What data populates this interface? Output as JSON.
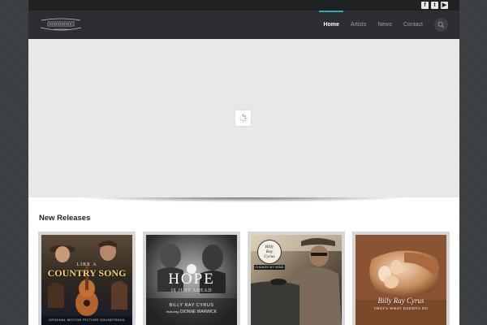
{
  "social": {
    "facebook": "f",
    "twitter": "t",
    "youtube": "▶"
  },
  "nav": {
    "items": [
      {
        "label": "Home",
        "active": true
      },
      {
        "label": "Artists",
        "active": false
      },
      {
        "label": "News",
        "active": false
      },
      {
        "label": "Contact",
        "active": false
      }
    ]
  },
  "section": {
    "title": "New Releases"
  },
  "releases": [
    {
      "title_line1": "LIKE A",
      "title_line2": "COUNTRY SONG",
      "footer": "ORIGINAL MOTION PICTURE SOUNDTRACK"
    },
    {
      "title": "HOPE",
      "subtitle": "IS JUST AHEAD",
      "artist": "BILLY RAY CYRUS",
      "featuring": "featuring",
      "guest": "DIONNE WARWICK"
    },
    {
      "badge_line1": "Billy",
      "badge_line2": "Ray",
      "badge_line3": "Cyrus",
      "badge_sub": "CHANGE MY MIND"
    },
    {
      "artist": "Billy Ray Cyrus",
      "title": "THAT'S WHAT DADDYS DO"
    }
  ],
  "colors": {
    "accent": "#3aa6b7",
    "header_bg": "#2c2e31",
    "topbar_bg": "#1f2123"
  }
}
